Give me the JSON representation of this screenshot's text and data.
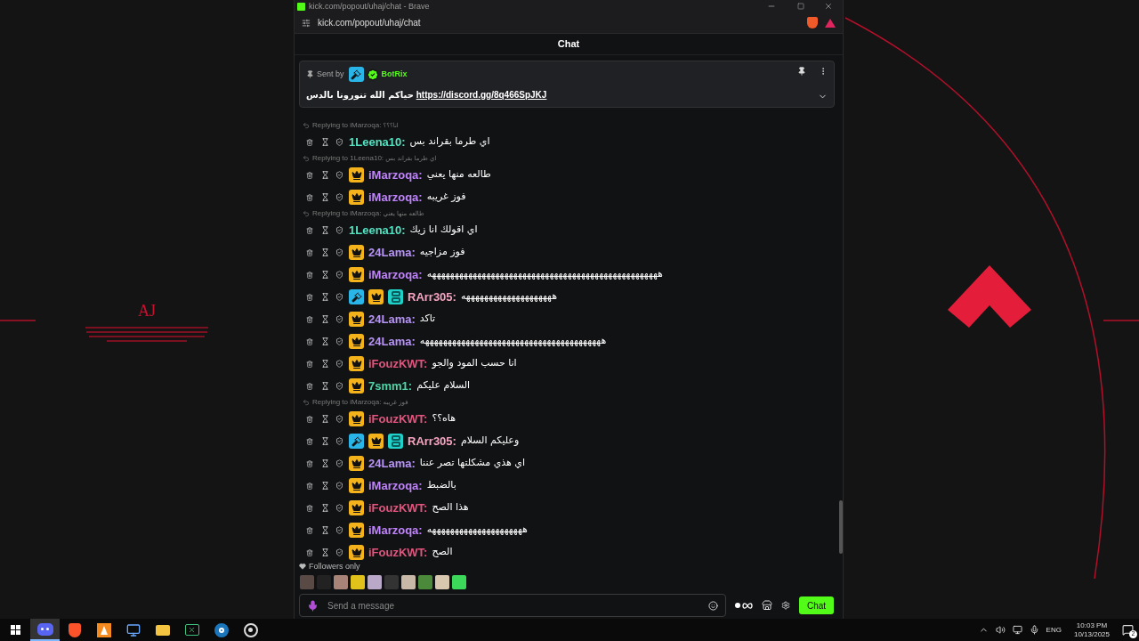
{
  "desktop": {
    "left_logo": "AJ"
  },
  "browser": {
    "title": "kick.com/popout/uhaj/chat - Brave",
    "address": "kick.com/popout/uhaj/chat"
  },
  "chat": {
    "header": "Chat",
    "pinned": {
      "sent_by": "Sent by",
      "author": "BotRix",
      "author_badges": [
        {
          "kind": "mod"
        },
        {
          "kind": "verified"
        }
      ],
      "text": "حياكم الله تنورونا بالدس",
      "link": "https://discord.gg/8q466SpJKJ"
    },
    "messages": [
      {
        "reply_to": "Replying to iMarzoqa:",
        "reply_text": "انا؟؟؟",
        "username": "1Leena10:",
        "color": "#52e3c2",
        "text": "اي طرما بقراند بس"
      },
      {
        "reply_to": "Replying to 1Leena10:",
        "reply_text": "اي طرما بقراند بس",
        "username": "iMarzoqa:",
        "color": "#c084fc",
        "badges": [
          {
            "kind": "sub"
          }
        ],
        "text": "طالعه منها يعني"
      },
      {
        "username": "iMarzoqa:",
        "color": "#c084fc",
        "badges": [
          {
            "kind": "sub"
          }
        ],
        "text": "فوز غريبه"
      },
      {
        "reply_to": "Replying to iMarzoqa:",
        "reply_text": "طالعه منها يعني",
        "username": "1Leena10:",
        "color": "#52e3c2",
        "text": "اي اقولك انا زيك"
      },
      {
        "username": "24Lama:",
        "color": "#b794f6",
        "badges": [
          {
            "kind": "sub"
          }
        ],
        "text": "فوز مزاجيه"
      },
      {
        "username": "iMarzoqa:",
        "color": "#c084fc",
        "badges": [
          {
            "kind": "sub"
          }
        ],
        "text": "هههههههههههههههههههههههههههههههههههههههههههههههههههه"
      },
      {
        "username": "RArr305:",
        "color": "#f6a5c0",
        "badges": [
          {
            "kind": "mod"
          },
          {
            "kind": "sub"
          },
          {
            "kind": "og"
          }
        ],
        "text": "ههههههههههههههههههههه"
      },
      {
        "username": "24Lama:",
        "color": "#b794f6",
        "badges": [
          {
            "kind": "sub"
          }
        ],
        "text": "تاكد"
      },
      {
        "username": "24Lama:",
        "color": "#b794f6",
        "badges": [
          {
            "kind": "sub"
          }
        ],
        "text": "ههههههههههههههههههههههههههههههههههههههههه"
      },
      {
        "username": "iFouzKWT:",
        "color": "#e2557f",
        "badges": [
          {
            "kind": "sub"
          }
        ],
        "text": "انا حسب المود والجو"
      },
      {
        "username": "7smm1:",
        "color": "#4fd6a8",
        "badges": [
          {
            "kind": "sub"
          }
        ],
        "text": "السلام عليكم"
      },
      {
        "reply_to": "Replying to iMarzoqa:",
        "reply_text": "فوز غريبه",
        "username": "iFouzKWT:",
        "color": "#e2557f",
        "badges": [
          {
            "kind": "sub"
          }
        ],
        "text": "هاه؟؟"
      },
      {
        "username": "RArr305:",
        "color": "#f6a5c0",
        "badges": [
          {
            "kind": "mod"
          },
          {
            "kind": "sub"
          },
          {
            "kind": "og"
          }
        ],
        "text": "وعليكم السلام"
      },
      {
        "username": "24Lama:",
        "color": "#b794f6",
        "badges": [
          {
            "kind": "sub"
          }
        ],
        "text": "اي هذي مشكلتها تصر عننا"
      },
      {
        "username": "iMarzoqa:",
        "color": "#c084fc",
        "badges": [
          {
            "kind": "sub"
          }
        ],
        "text": "بالضبط"
      },
      {
        "username": "iFouzKWT:",
        "color": "#e2557f",
        "badges": [
          {
            "kind": "sub"
          }
        ],
        "text": "هذا الصح"
      },
      {
        "username": "iMarzoqa:",
        "color": "#c084fc",
        "badges": [
          {
            "kind": "sub"
          }
        ],
        "text": "هههههههههههههههههههههه"
      },
      {
        "username": "iFouzKWT:",
        "color": "#e2557f",
        "badges": [
          {
            "kind": "sub"
          }
        ],
        "text": "الصح"
      }
    ],
    "mode": "Followers only",
    "input": {
      "placeholder": "Send a message"
    },
    "send_button": "Chat"
  },
  "taskbar": {
    "apps": [
      {
        "kind": "discord",
        "selected": true
      },
      {
        "kind": "brave",
        "selected": false
      },
      {
        "kind": "orange",
        "selected": false
      },
      {
        "kind": "network",
        "selected": false
      },
      {
        "kind": "folder",
        "selected": false
      },
      {
        "kind": "terminal",
        "selected": false
      },
      {
        "kind": "steam",
        "selected": false
      },
      {
        "kind": "obs",
        "selected": false
      }
    ],
    "language": "ENG",
    "time": "10:03 PM",
    "date": "10/13/2025",
    "notifications": "2"
  }
}
